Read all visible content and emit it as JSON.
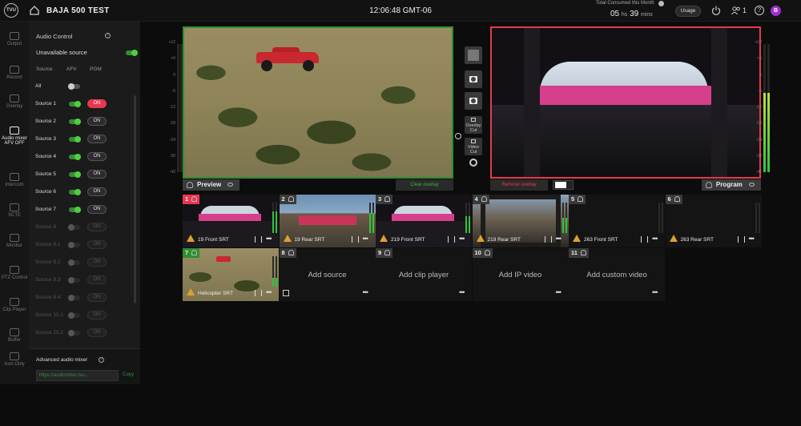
{
  "topbar": {
    "logo": "TVU",
    "title": "BAJA 500 TEST",
    "clock": "12:06:48 GMT-06",
    "consumed_label": "Total Consumed this Month",
    "consumed_hours": "05",
    "consumed_hours_unit": "hs",
    "consumed_mins": "39",
    "consumed_mins_unit": "mins",
    "usage_label": "Usage",
    "users_count": "1",
    "help": "?",
    "avatar": "B"
  },
  "leftnav": {
    "items": [
      {
        "label": "Output",
        "icon": "output-icon"
      },
      {
        "label": "Record",
        "icon": "record-icon"
      },
      {
        "label": "Overlay",
        "icon": "overlay-icon"
      },
      {
        "label": "Audio mixer AFV OFF",
        "icon": "audio-mixer-icon",
        "active": true
      },
      {
        "label": "Intercom",
        "icon": "intercom-icon"
      },
      {
        "label": "SCTE",
        "icon": "scte-icon"
      },
      {
        "label": "Monitor",
        "icon": "monitor-icon"
      },
      {
        "label": "PTZ Control",
        "icon": "ptz-icon"
      },
      {
        "label": "Clip Player",
        "icon": "clip-player-icon"
      },
      {
        "label": "Buffer",
        "icon": "buffer-icon"
      },
      {
        "label": "Icon Only",
        "icon": "icon-only-icon"
      }
    ]
  },
  "audio_panel": {
    "title": "Audio Control",
    "unavailable_label": "Unavailable source",
    "col_source": "Source",
    "col_afv": "AFV",
    "col_pgm": "PGM",
    "all_label": "All",
    "sources": [
      {
        "label": "Source 1",
        "pgm": "ON",
        "live": true,
        "red": true
      },
      {
        "label": "Source 2",
        "pgm": "ON",
        "live": true
      },
      {
        "label": "Source 3",
        "pgm": "ON",
        "live": true
      },
      {
        "label": "Source 4",
        "pgm": "ON",
        "live": true
      },
      {
        "label": "Source 5",
        "pgm": "ON",
        "live": true
      },
      {
        "label": "Source 6",
        "pgm": "ON",
        "live": true
      },
      {
        "label": "Source 7",
        "pgm": "ON",
        "live": true
      },
      {
        "label": "Source 8",
        "pgm": "ON",
        "live": false
      },
      {
        "label": "Source 9.1",
        "pgm": "ON",
        "live": false
      },
      {
        "label": "Source 9.2",
        "pgm": "ON",
        "live": false
      },
      {
        "label": "Source 9.3",
        "pgm": "ON",
        "live": false
      },
      {
        "label": "Source 9.4",
        "pgm": "ON",
        "live": false
      },
      {
        "label": "Source 10.1",
        "pgm": "ON",
        "live": false
      },
      {
        "label": "Source 10.2",
        "pgm": "ON",
        "live": false
      }
    ],
    "advanced_label": "Advanced audio mixer",
    "advanced_url": "https://audiomixer.tvu...",
    "advanced_copy": "Copy"
  },
  "preview": {
    "label": "Preview",
    "clear_overlay": "Clear overlay"
  },
  "program": {
    "label": "Program",
    "remove_overlay": "Remove overlay"
  },
  "meter_scale": [
    "+12",
    "+6",
    "0",
    "-6",
    "-12",
    "-18",
    "-24",
    "-30",
    "-42"
  ],
  "controls": {
    "overlay_cut": "Overlay Cut",
    "video_cut": "Video Cut"
  },
  "sources": [
    {
      "num": "1",
      "name": "19 Front SRT",
      "state": "program"
    },
    {
      "num": "2",
      "name": "19 Rear SRT",
      "state": "normal"
    },
    {
      "num": "3",
      "name": "219 Front SRT",
      "state": "normal"
    },
    {
      "num": "4",
      "name": "219 Rear SRT",
      "state": "normal"
    },
    {
      "num": "5",
      "name": "263 Front SRT",
      "state": "normal"
    },
    {
      "num": "6",
      "name": "263 Rear SRT",
      "state": "normal"
    },
    {
      "num": "7",
      "name": "Helicopter SRT",
      "state": "preview"
    },
    {
      "num": "8",
      "name": "Add source",
      "state": "empty"
    },
    {
      "num": "9",
      "name": "Add clip player",
      "state": "empty"
    },
    {
      "num": "10",
      "name": "Add IP video",
      "state": "empty"
    },
    {
      "num": "11",
      "name": "Add custom video",
      "state": "empty"
    }
  ],
  "colors": {
    "program_red": "#e8384f",
    "preview_green": "#2e8f2e",
    "toggle_green": "#4ecf3f",
    "avatar": "#9b2fd0"
  }
}
